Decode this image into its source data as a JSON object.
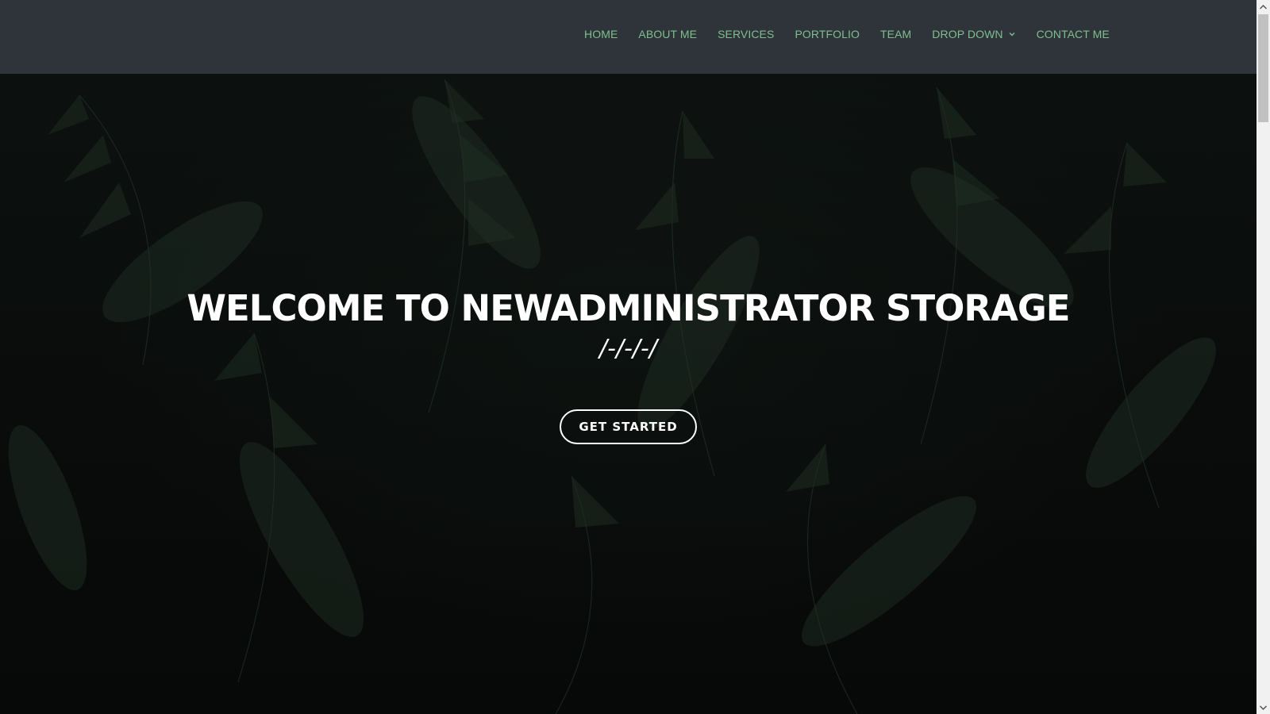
{
  "nav": {
    "items": [
      {
        "label": "HOME"
      },
      {
        "label": "ABOUT ME"
      },
      {
        "label": "SERVICES"
      },
      {
        "label": "PORTFOLIO"
      },
      {
        "label": "TEAM"
      },
      {
        "label": "DROP DOWN",
        "icon": "chevron-down-icon"
      },
      {
        "label": "CONTACT ME"
      }
    ]
  },
  "hero": {
    "title": "WELCOME TO NEWADMINISTRATOR STORAGE",
    "subtitle": "/-/-/-/",
    "cta_label": "GET STARTED"
  },
  "colors": {
    "nav_text": "#7fbf8e",
    "header_bg": "#343a40",
    "hero_text": "#ffffff"
  }
}
